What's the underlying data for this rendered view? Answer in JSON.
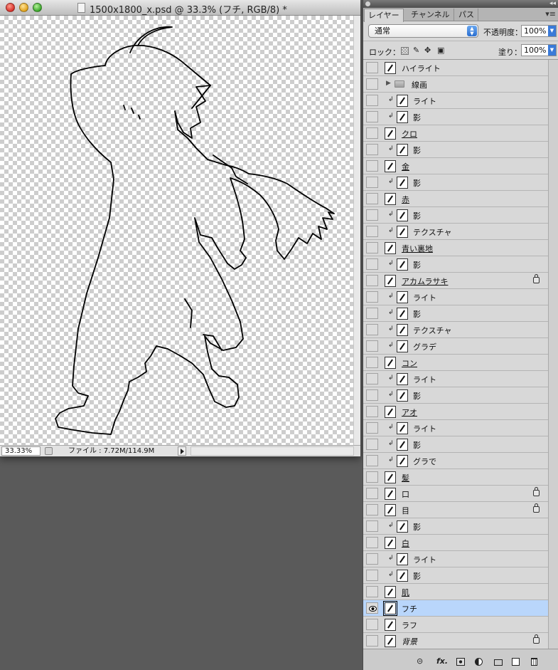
{
  "document": {
    "title": "1500x1800_x.psd @ 33.3% (フチ, RGB/8) *",
    "zoom": "33.33%",
    "file_info": "ファイル : 7.72M/114.9M"
  },
  "panel": {
    "tabs": [
      "レイヤー",
      "チャンネル",
      "パス"
    ],
    "active_tab": "レイヤー",
    "collapse_glyph": "◂◂",
    "menu_glyph": "▾≡",
    "blend_mode": "通常",
    "opacity_label": "不透明度：",
    "opacity_value": "100%",
    "lock_label": "ロック：",
    "fill_label": "塗り：",
    "fill_value": "100%",
    "lock_icons": [
      "lock-transparent-icon",
      "lock-image-brush-icon",
      "lock-position-move-icon",
      "lock-all-icon"
    ],
    "selection_color": "#b9d6fb"
  },
  "layers": [
    {
      "name": "ハイライト",
      "clipped": false,
      "group": false,
      "locked": false,
      "visible": false,
      "underline": false
    },
    {
      "name": "線画",
      "clipped": false,
      "group": true,
      "locked": false,
      "visible": false,
      "underline": false
    },
    {
      "name": "ライト",
      "clipped": true,
      "group": false,
      "locked": false,
      "visible": false,
      "underline": false
    },
    {
      "name": "影",
      "clipped": true,
      "group": false,
      "locked": false,
      "visible": false,
      "underline": false
    },
    {
      "name": "クロ",
      "clipped": false,
      "group": false,
      "locked": false,
      "visible": false,
      "underline": true
    },
    {
      "name": "影",
      "clipped": true,
      "group": false,
      "locked": false,
      "visible": false,
      "underline": false
    },
    {
      "name": "金",
      "clipped": false,
      "group": false,
      "locked": false,
      "visible": false,
      "underline": true
    },
    {
      "name": "影",
      "clipped": true,
      "group": false,
      "locked": false,
      "visible": false,
      "underline": false
    },
    {
      "name": "赤",
      "clipped": false,
      "group": false,
      "locked": false,
      "visible": false,
      "underline": true
    },
    {
      "name": "影",
      "clipped": true,
      "group": false,
      "locked": false,
      "visible": false,
      "underline": false
    },
    {
      "name": "テクスチャ",
      "clipped": true,
      "group": false,
      "locked": false,
      "visible": false,
      "underline": false
    },
    {
      "name": "青い裏地",
      "clipped": false,
      "group": false,
      "locked": false,
      "visible": false,
      "underline": true
    },
    {
      "name": "影",
      "clipped": true,
      "group": false,
      "locked": false,
      "visible": false,
      "underline": false
    },
    {
      "name": "アカムラサキ",
      "clipped": false,
      "group": false,
      "locked": true,
      "visible": false,
      "underline": true
    },
    {
      "name": "ライト",
      "clipped": true,
      "group": false,
      "locked": false,
      "visible": false,
      "underline": false
    },
    {
      "name": "影",
      "clipped": true,
      "group": false,
      "locked": false,
      "visible": false,
      "underline": false
    },
    {
      "name": "テクスチャ",
      "clipped": true,
      "group": false,
      "locked": false,
      "visible": false,
      "underline": false
    },
    {
      "name": "グラデ",
      "clipped": true,
      "group": false,
      "locked": false,
      "visible": false,
      "underline": false
    },
    {
      "name": "コン",
      "clipped": false,
      "group": false,
      "locked": false,
      "visible": false,
      "underline": true
    },
    {
      "name": "ライト",
      "clipped": true,
      "group": false,
      "locked": false,
      "visible": false,
      "underline": false
    },
    {
      "name": "影",
      "clipped": true,
      "group": false,
      "locked": false,
      "visible": false,
      "underline": false
    },
    {
      "name": "アオ",
      "clipped": false,
      "group": false,
      "locked": false,
      "visible": false,
      "underline": true
    },
    {
      "name": "ライト",
      "clipped": true,
      "group": false,
      "locked": false,
      "visible": false,
      "underline": false
    },
    {
      "name": "影",
      "clipped": true,
      "group": false,
      "locked": false,
      "visible": false,
      "underline": false
    },
    {
      "name": "グラで",
      "clipped": true,
      "group": false,
      "locked": false,
      "visible": false,
      "underline": false
    },
    {
      "name": "髪",
      "clipped": false,
      "group": false,
      "locked": false,
      "visible": false,
      "underline": true
    },
    {
      "name": "口",
      "clipped": false,
      "group": false,
      "locked": true,
      "visible": false,
      "underline": false
    },
    {
      "name": "目",
      "clipped": false,
      "group": false,
      "locked": true,
      "visible": false,
      "underline": false
    },
    {
      "name": "影",
      "clipped": true,
      "group": false,
      "locked": false,
      "visible": false,
      "underline": false
    },
    {
      "name": "白",
      "clipped": false,
      "group": false,
      "locked": false,
      "visible": false,
      "underline": true
    },
    {
      "name": "ライト",
      "clipped": true,
      "group": false,
      "locked": false,
      "visible": false,
      "underline": false
    },
    {
      "name": "影",
      "clipped": true,
      "group": false,
      "locked": false,
      "visible": false,
      "underline": false
    },
    {
      "name": "肌",
      "clipped": false,
      "group": false,
      "locked": false,
      "visible": false,
      "underline": true
    },
    {
      "name": "フチ",
      "clipped": false,
      "group": false,
      "locked": false,
      "visible": true,
      "underline": false,
      "selected": true
    },
    {
      "name": "ラフ",
      "clipped": false,
      "group": false,
      "locked": false,
      "visible": false,
      "underline": false
    },
    {
      "name": "背景",
      "clipped": false,
      "group": false,
      "locked": true,
      "visible": false,
      "underline": false,
      "italic": true
    }
  ],
  "bottom_bar_icons": [
    "link-layers-icon",
    "layer-style-fx-icon",
    "add-mask-icon",
    "adjustment-layer-icon",
    "new-group-icon",
    "new-layer-icon",
    "trash-icon"
  ],
  "bottom_bar_glyphs": {
    "link": "⊝",
    "fx": "fx."
  }
}
